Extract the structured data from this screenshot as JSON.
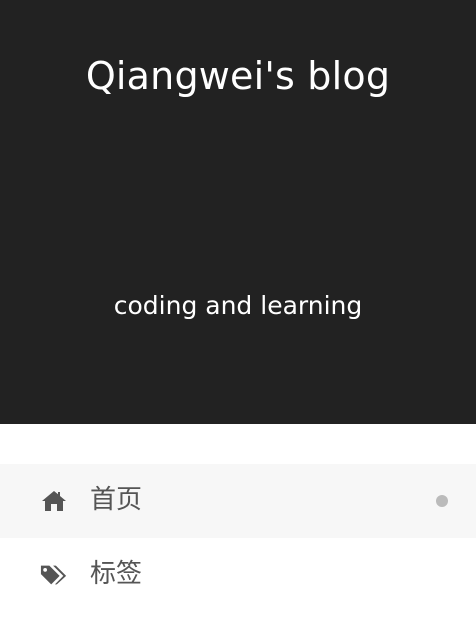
{
  "header": {
    "title": "Qiangwei's blog",
    "subtitle": "coding and learning",
    "background": "#222222"
  },
  "menu": {
    "items": [
      {
        "label": "首页",
        "icon": "home-icon",
        "active": true
      },
      {
        "label": "标签",
        "icon": "tags-icon",
        "active": false
      }
    ]
  }
}
